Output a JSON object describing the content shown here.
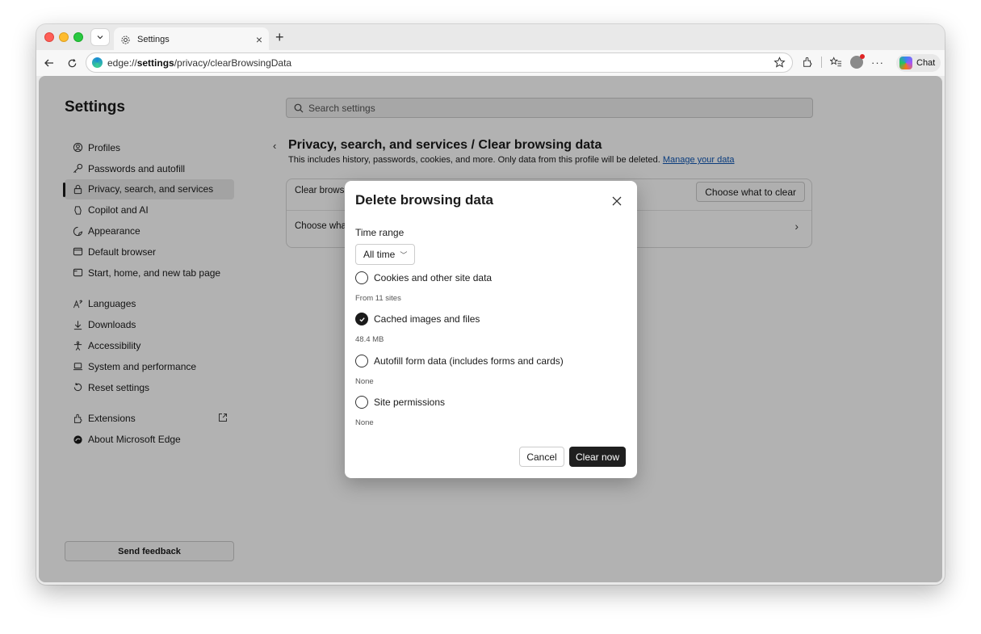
{
  "browser": {
    "tab": {
      "title": "Settings"
    },
    "address": {
      "prefix": "edge://",
      "bold": "settings",
      "rest": "/privacy/clearBrowsingData"
    },
    "chat_label": "Chat"
  },
  "settings": {
    "title": "Settings",
    "search_placeholder": "Search settings",
    "sidebar": {
      "items": [
        {
          "label": "Profiles",
          "icon": "profiles-icon"
        },
        {
          "label": "Passwords and autofill",
          "icon": "key-icon"
        },
        {
          "label": "Privacy, search, and services",
          "icon": "lock-icon",
          "active": true
        },
        {
          "label": "Copilot and AI",
          "icon": "copilot-icon"
        },
        {
          "label": "Appearance",
          "icon": "appearance-icon"
        },
        {
          "label": "Default browser",
          "icon": "browser-icon"
        },
        {
          "label": "Start, home, and new tab page",
          "icon": "home-icon"
        },
        {
          "label": "Languages",
          "icon": "languages-icon"
        },
        {
          "label": "Downloads",
          "icon": "download-icon"
        },
        {
          "label": "Accessibility",
          "icon": "accessibility-icon"
        },
        {
          "label": "System and performance",
          "icon": "laptop-icon"
        },
        {
          "label": "Reset settings",
          "icon": "reset-icon"
        },
        {
          "label": "Extensions",
          "icon": "extensions-icon"
        },
        {
          "label": "About Microsoft Edge",
          "icon": "edge-icon"
        }
      ]
    },
    "send_feedback": "Send feedback"
  },
  "page": {
    "title": "Privacy, search, and services / Clear browsing data",
    "description": "This includes history, passwords, cookies, and more. Only data from this profile will be deleted.",
    "manage_link": "Manage your data",
    "card": {
      "row1": "Clear brows",
      "row2": "Choose wha",
      "choose_button": "Choose what to clear"
    }
  },
  "dialog": {
    "title": "Delete browsing data",
    "time_range_label": "Time range",
    "time_range_value": "All time",
    "options": [
      {
        "label": "Cookies and other site data",
        "sub": "From 11 sites",
        "checked": false
      },
      {
        "label": "Cached images and files",
        "sub": "48.4 MB",
        "checked": true
      },
      {
        "label": "Autofill form data (includes forms and cards)",
        "sub": "None",
        "checked": false
      },
      {
        "label": "Site permissions",
        "sub": "None",
        "checked": false
      }
    ],
    "cancel_label": "Cancel",
    "clear_label": "Clear now"
  }
}
